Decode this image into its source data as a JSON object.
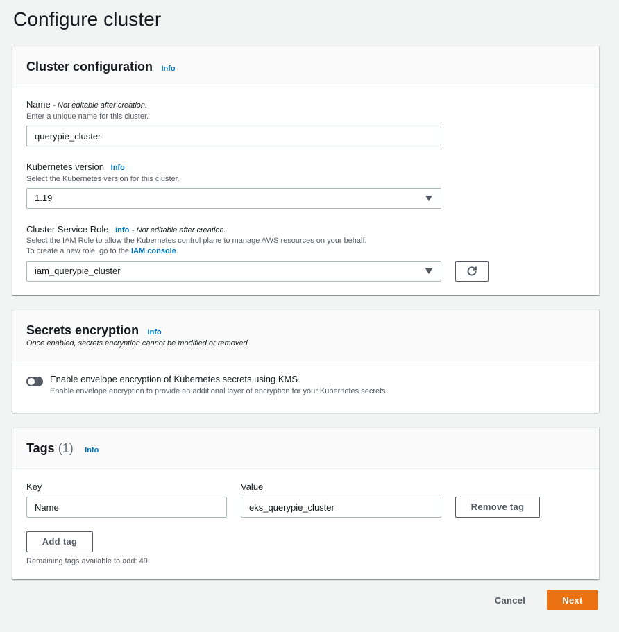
{
  "page": {
    "title": "Configure cluster"
  },
  "cluster_config": {
    "title": "Cluster configuration",
    "info": "Info",
    "name": {
      "label": "Name",
      "note": "- Not editable after creation.",
      "description": "Enter a unique name for this cluster.",
      "value": "querypie_cluster"
    },
    "k8s_version": {
      "label": "Kubernetes version",
      "info": "Info",
      "description": "Select the Kubernetes version for this cluster.",
      "value": "1.19"
    },
    "service_role": {
      "label": "Cluster Service Role",
      "info": "Info",
      "note": "- Not editable after creation.",
      "description_line1": "Select the IAM Role to allow the Kubernetes control plane to manage AWS resources on your behalf.",
      "description_line2_prefix": "To create a new role, go to the",
      "iam_console_link": "IAM console",
      "description_line2_suffix": ".",
      "value": "iam_querypie_cluster",
      "refresh_icon": "refresh-icon"
    }
  },
  "secrets": {
    "title": "Secrets encryption",
    "info": "Info",
    "description": "Once enabled, secrets encryption cannot be modified or removed.",
    "toggle_label": "Enable envelope encryption of Kubernetes secrets using KMS",
    "toggle_description": "Enable envelope encryption to provide an additional layer of encryption for your Kubernetes secrets.",
    "enabled": false
  },
  "tags": {
    "title": "Tags",
    "count": "(1)",
    "info": "Info",
    "key_header": "Key",
    "value_header": "Value",
    "rows": [
      {
        "key": "Name",
        "value": "eks_querypie_cluster"
      }
    ],
    "remove_label": "Remove tag",
    "add_label": "Add tag",
    "remaining": "Remaining tags available to add: 49"
  },
  "footer": {
    "cancel_label": "Cancel",
    "next_label": "Next"
  },
  "colors": {
    "primary": "#ec7211",
    "link": "#0073bb",
    "background": "#f2f3f3"
  }
}
